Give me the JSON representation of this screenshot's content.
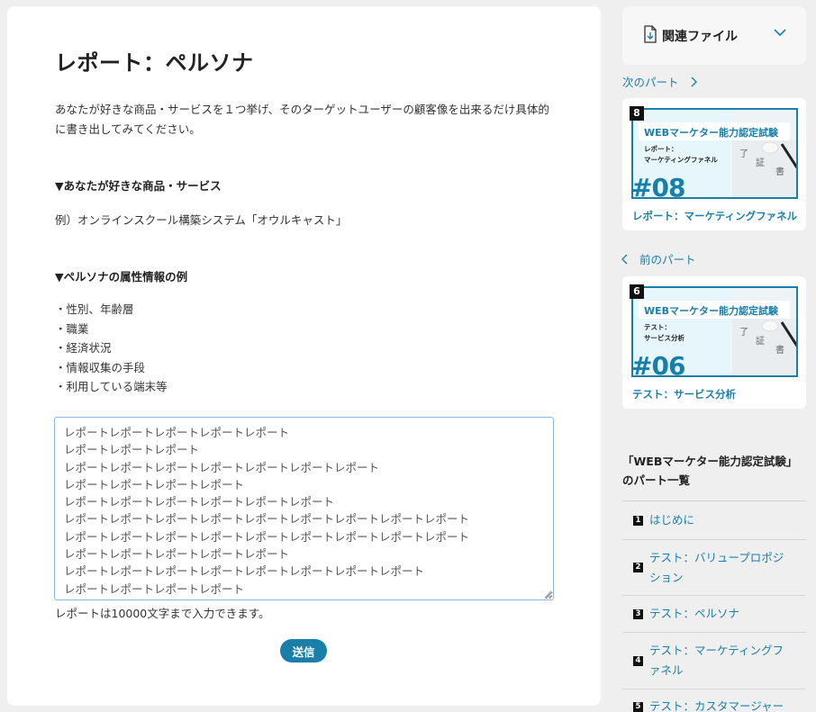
{
  "main": {
    "title": "レポート：ペルソナ",
    "intro": "あなたが好きな商品・サービスを１つ挙げ、そのターゲットユーザーの顧客像を出来るだけ具体的に書き出してみてください。",
    "section1_heading": "▼あなたが好きな商品・サービス",
    "example": "例）オンラインスクール構築システム「オウルキャスト」",
    "section2_heading": "▼ペルソナの属性情報の例",
    "attributes": [
      "・性別、年齢層",
      "・職業",
      "・経済状況",
      "・情報収集の手段",
      "・利用している端末等"
    ],
    "report_lines": [
      "レポートレポートレポートレポートレポート",
      "レポートレポートレポート",
      "レポートレポートレポートレポートレポートレポートレポート",
      "レポートレポートレポートレポート",
      "レポートレポートレポートレポートレポートレポート",
      "レポートレポートレポートレポートレポートレポートレポートレポートレポート",
      "レポートレポートレポートレポートレポートレポートレポートレポートレポート",
      "レポートレポートレポートレポートレポート",
      "レポートレポートレポートレポートレポートレポートレポートレポート",
      "レポートレポートレポートレポート"
    ],
    "limit_note": "レポートは10000文字まで入力できます。",
    "submit_label": "送信"
  },
  "sidebar": {
    "files_label": "関連ファイル",
    "next_label": "次のパート",
    "prev_label": "前のパート",
    "next_part": {
      "badge": "8",
      "banner": "WEBマーケター能力認定試験",
      "sub1": "レポート：",
      "sub2": "マーケティングファネル",
      "number": "#08",
      "title": "レポート：マーケティングファネル"
    },
    "prev_part": {
      "badge": "6",
      "banner": "WEBマーケター能力認定試験",
      "sub1": "テスト：",
      "sub2": "サービス分析",
      "number": "#06",
      "title": "テスト：サービス分析"
    },
    "list_heading_1": "「WEBマーケター能力認定試験」",
    "list_heading_2": "のパート一覧",
    "toc": [
      {
        "num": "1",
        "label": "はじめに"
      },
      {
        "num": "2",
        "label": "テスト：バリュープロポジション"
      },
      {
        "num": "3",
        "label": "テスト：ペルソナ"
      },
      {
        "num": "4",
        "label": "テスト：マーケティングファネル"
      },
      {
        "num": "5",
        "label": "テスト：カスタマージャーニー"
      }
    ],
    "accent_color": "#1a7fa8"
  }
}
